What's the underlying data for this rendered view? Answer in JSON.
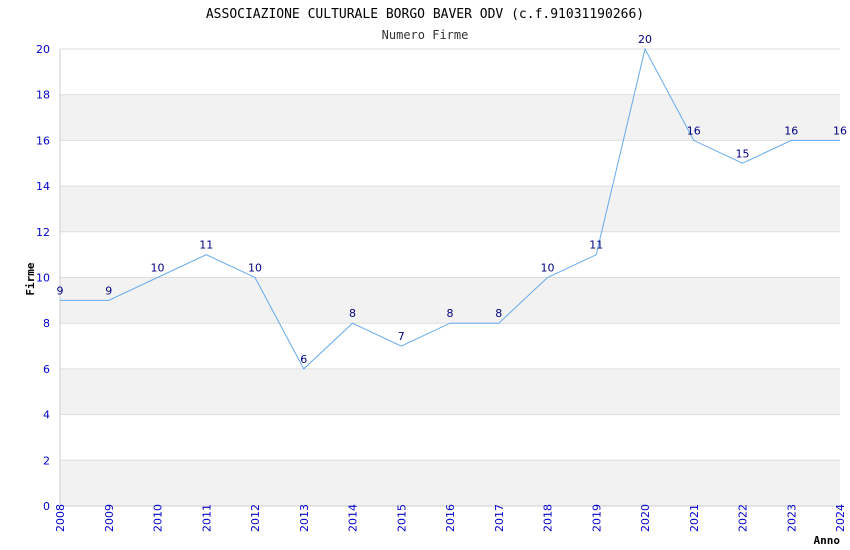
{
  "chart_data": {
    "type": "line",
    "title": "ASSOCIAZIONE CULTURALE BORGO BAVER ODV (c.f.91031190266)",
    "subtitle": "Numero Firme",
    "xlabel": "Anno",
    "ylabel": "Firme",
    "x": [
      "2008",
      "2009",
      "2010",
      "2011",
      "2012",
      "2013",
      "2014",
      "2015",
      "2016",
      "2017",
      "2018",
      "2019",
      "2020",
      "2021",
      "2022",
      "2023",
      "2024"
    ],
    "series": [
      {
        "values": [
          9,
          9,
          10,
          11,
          10,
          6,
          8,
          7,
          8,
          8,
          10,
          11,
          20,
          16,
          15,
          16,
          16
        ]
      }
    ],
    "ylim": [
      0,
      20
    ],
    "yticks": [
      0,
      2,
      4,
      6,
      8,
      10,
      12,
      14,
      16,
      18,
      20
    ],
    "grid": true,
    "legend": "none",
    "colors": {
      "line": "#66aaee",
      "band": "#f2f2f2",
      "gridline": "#dddddd",
      "tick_text": "#0000cc",
      "label_text": "#000080"
    }
  }
}
